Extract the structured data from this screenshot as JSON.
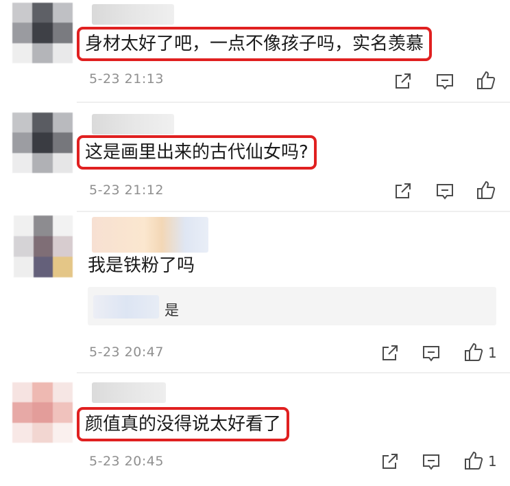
{
  "comments": [
    {
      "text": "身材太好了吧，一点不像孩子吗，实名羡慕",
      "time": "5-23 21:13",
      "likes": ""
    },
    {
      "text": "这是画里出来的古代仙女吗?",
      "time": "5-23 21:12",
      "likes": ""
    },
    {
      "text": "我是铁粉了吗",
      "time": "5-23 20:47",
      "likes": "1",
      "reply": {
        "text": "是"
      }
    },
    {
      "text": "颜值真的没得说太好看了",
      "time": "5-23 20:45",
      "likes": "1"
    }
  ],
  "icons": {
    "share": "share-icon",
    "reply": "comment-icon",
    "like": "thumbs-up-icon"
  },
  "colors": {
    "highlight_border": "#e02020",
    "timestamp": "#8f8f8f",
    "reply_bg": "#f4f4f4"
  }
}
